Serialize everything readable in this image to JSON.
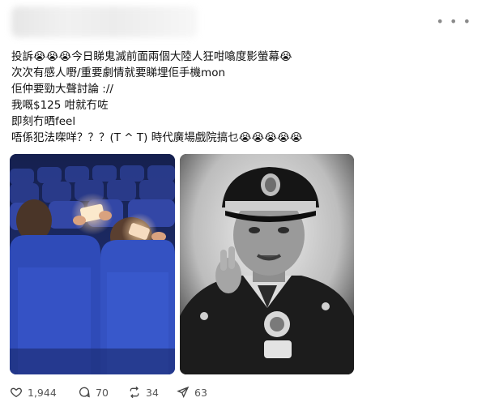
{
  "post": {
    "lines": [
      "投訴😭😭😭今日睇鬼滅前面兩個大陸人狂咁噏度影螢幕😭",
      "次次有感人嘢/重要劇情就要睇埋佢手機mon",
      "佢仲要勁大聲討論 ://",
      "我嘅$125 咁就冇咗",
      "即刻冇晒feel",
      "唔係犯法㗎咩？？？(T ^ T) 時代廣場戲院搞乜😭😭😭😭😭"
    ]
  },
  "actions": {
    "likes": "1,944",
    "comments": "70",
    "reposts": "34",
    "shares": "63"
  },
  "icons": {
    "more": "more-options-icon",
    "like": "heart-icon",
    "comment": "comment-icon",
    "repost": "repost-icon",
    "share": "share-icon"
  }
}
